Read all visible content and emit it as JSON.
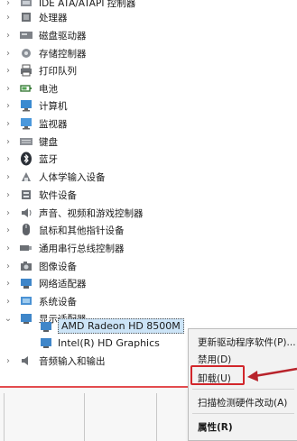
{
  "tree": [
    {
      "label": "IDE ATA/ATAPI 控制器",
      "icon": "ide-controller-icon",
      "expanded": false
    },
    {
      "label": "处理器",
      "icon": "processor-icon",
      "expanded": false
    },
    {
      "label": "磁盘驱动器",
      "icon": "disk-drive-icon",
      "expanded": false
    },
    {
      "label": "存储控制器",
      "icon": "storage-controller-icon",
      "expanded": false
    },
    {
      "label": "打印队列",
      "icon": "printer-icon",
      "expanded": false
    },
    {
      "label": "电池",
      "icon": "battery-icon",
      "expanded": false
    },
    {
      "label": "计算机",
      "icon": "computer-icon",
      "expanded": false
    },
    {
      "label": "监视器",
      "icon": "monitor-icon",
      "expanded": false
    },
    {
      "label": "键盘",
      "icon": "keyboard-icon",
      "expanded": false
    },
    {
      "label": "蓝牙",
      "icon": "bluetooth-icon",
      "expanded": false
    },
    {
      "label": "人体学输入设备",
      "icon": "hid-icon",
      "expanded": false
    },
    {
      "label": "软件设备",
      "icon": "software-device-icon",
      "expanded": false
    },
    {
      "label": "声音、视频和游戏控制器",
      "icon": "sound-icon",
      "expanded": false
    },
    {
      "label": "鼠标和其他指针设备",
      "icon": "mouse-icon",
      "expanded": false
    },
    {
      "label": "通用串行总线控制器",
      "icon": "usb-icon",
      "expanded": false
    },
    {
      "label": "图像设备",
      "icon": "camera-icon",
      "expanded": false
    },
    {
      "label": "网络适配器",
      "icon": "network-adapter-icon",
      "expanded": false
    },
    {
      "label": "系统设备",
      "icon": "system-device-icon",
      "expanded": false
    },
    {
      "label": "显示适配器",
      "icon": "display-adapter-icon",
      "expanded": true
    }
  ],
  "display_children": [
    {
      "label": "AMD Radeon HD 8500M",
      "selected": true
    },
    {
      "label": "Intel(R) HD Graphics",
      "selected": false
    }
  ],
  "after_tree": [
    {
      "label": "音频输入和输出",
      "icon": "audio-io-icon"
    }
  ],
  "context_menu": {
    "update_driver": "更新驱动程序软件(P)...",
    "disable": "禁用(D)",
    "uninstall": "卸载(U)",
    "scan": "扫描检测硬件改动(A)",
    "properties": "属性(R)"
  },
  "colors": {
    "highlight": "#d2262b",
    "selection": "#cce4f7"
  }
}
